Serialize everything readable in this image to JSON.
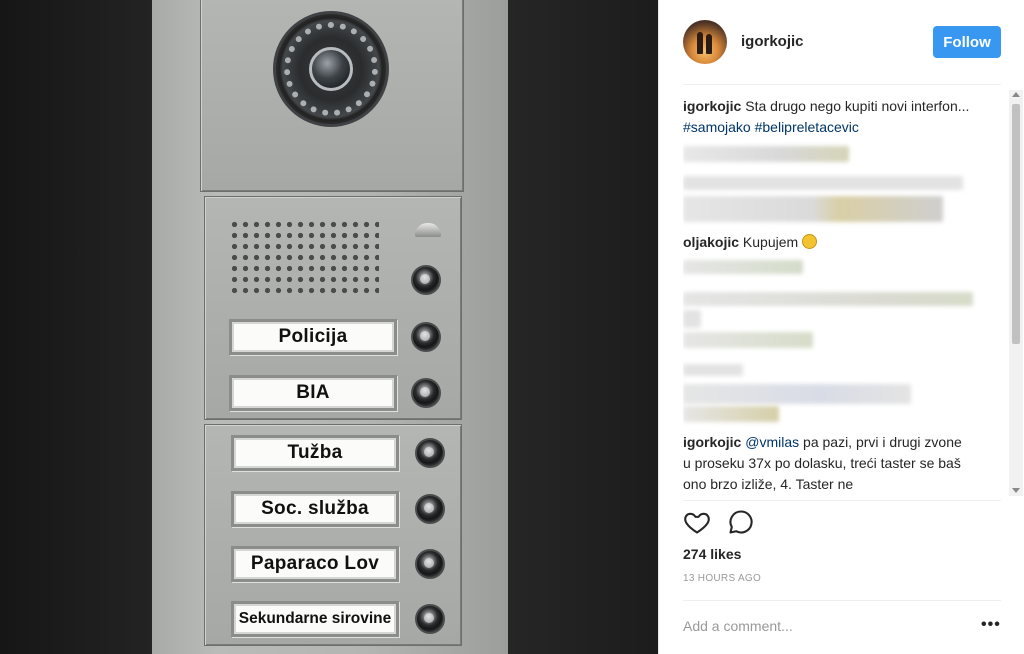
{
  "photo": {
    "name_plates": [
      "Policija",
      "BIA",
      "Tužba",
      "Soc. služba",
      "Paparaco Lov",
      "Sekundarne sirovine"
    ]
  },
  "post": {
    "username": "igorkojic",
    "follow_label": "Follow",
    "caption": {
      "user": "igorkojic",
      "text": " Sta drugo nego kupiti novi interfon... ",
      "tags": [
        "#samojako",
        "#belipreletacevic"
      ]
    },
    "comments": [
      {
        "user": "oljakojic",
        "text": " Kupujem"
      },
      {
        "user": "igorkojic",
        "mention": "@vmilas",
        "text": " pa pazi, prvi i drugi zvone u proseku 37x po dolasku, treći taster se baš ono brzo izliže, 4. Taster ne"
      }
    ],
    "likes": "274 likes",
    "time_ago": "13 HOURS AGO",
    "add_comment_placeholder": "Add a comment...",
    "more_label": "•••"
  },
  "icons": {
    "like": "heart-icon",
    "comment": "comment-icon",
    "emoji": "grinning-emoji-icon"
  },
  "colors": {
    "follow_button": "#3897f0",
    "hashtag": "#003569"
  }
}
